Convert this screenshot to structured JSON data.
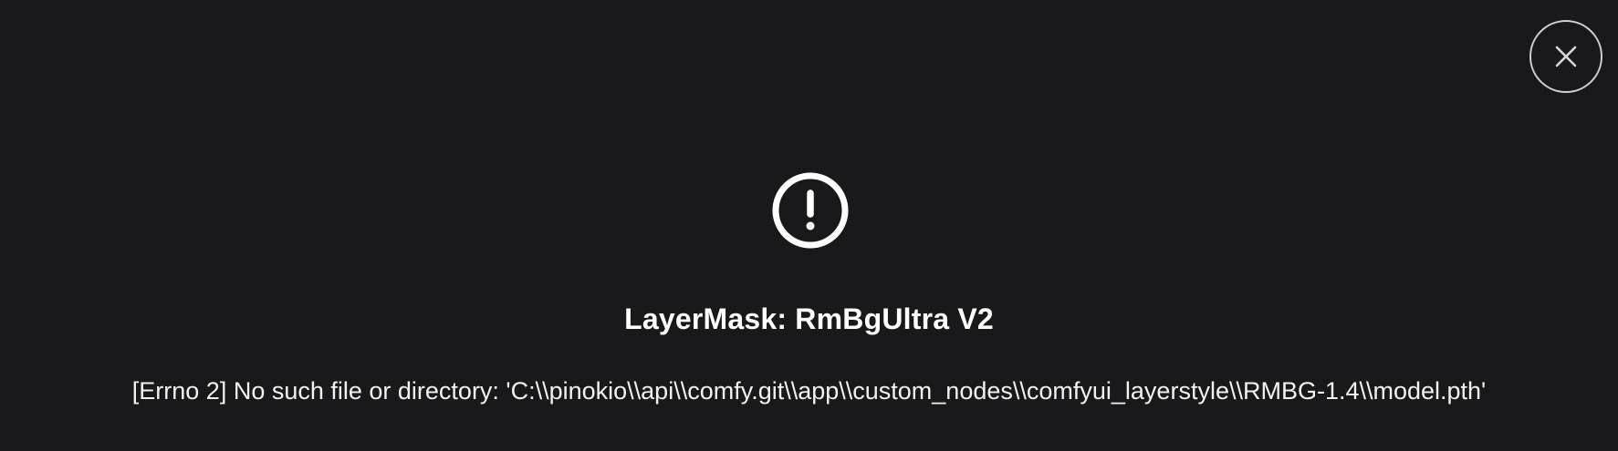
{
  "dialog": {
    "title": "LayerMask: RmBgUltra V2",
    "message": "[Errno 2] No such file or directory: 'C:\\\\pinokio\\\\api\\\\comfy.git\\\\app\\\\custom_nodes\\\\comfyui_layerstyle\\\\RMBG-1.4\\\\model.pth'",
    "icon": "alert-circle-icon",
    "close_icon": "close-icon"
  },
  "colors": {
    "background": "#19191b",
    "text": "#ffffff",
    "close_border": "#cfcfd2"
  }
}
